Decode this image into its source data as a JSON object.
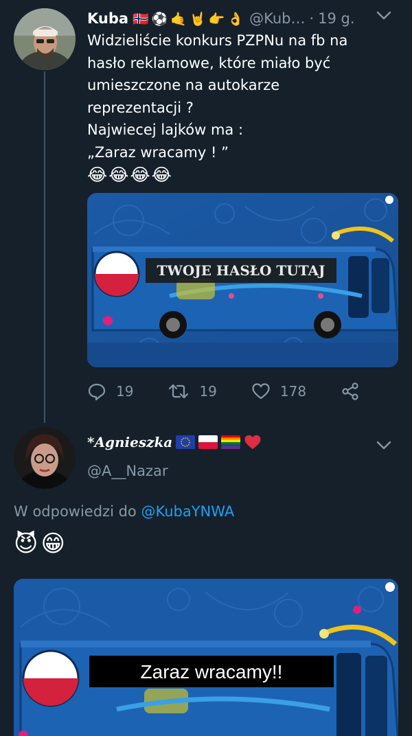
{
  "tweet1": {
    "name": "Kuba",
    "name_emojis": [
      "🇳🇴",
      "⚽",
      "🤙",
      "🤘",
      "👉",
      "👌"
    ],
    "handle": "@Kub…",
    "separator": "·",
    "time": "19 g.",
    "text_lines": [
      "Widzieliście konkurs PZPNu na fb na",
      "hasło reklamowe, które miało być",
      "umieszczone na autokarze",
      "reprezentacji ?",
      "Najwiecej lajków ma :",
      "„Zaraz wracamy ! ”"
    ],
    "laugh_emojis": [
      "😂",
      "😂",
      "😂",
      "😂"
    ],
    "media_caption": "TWOJE HASŁO TUTAJ",
    "actions": {
      "replies": "19",
      "retweets": "19",
      "likes": "178"
    }
  },
  "tweet2": {
    "name": "*Agnieszka",
    "handle": "@A__Nazar",
    "reply_prefix": "W odpowiedzi do",
    "reply_to": "@KubaYNWA",
    "emojis": [
      "😈",
      "😁"
    ],
    "media_caption": "Zaraz wracamy!!"
  },
  "colors": {
    "background": "#15202b",
    "secondary_text": "#8899a6",
    "link": "#1da1f2",
    "thread_line": "#3d5466",
    "heart": "#dd2e44",
    "bus_blue": "#1f5fa8"
  }
}
